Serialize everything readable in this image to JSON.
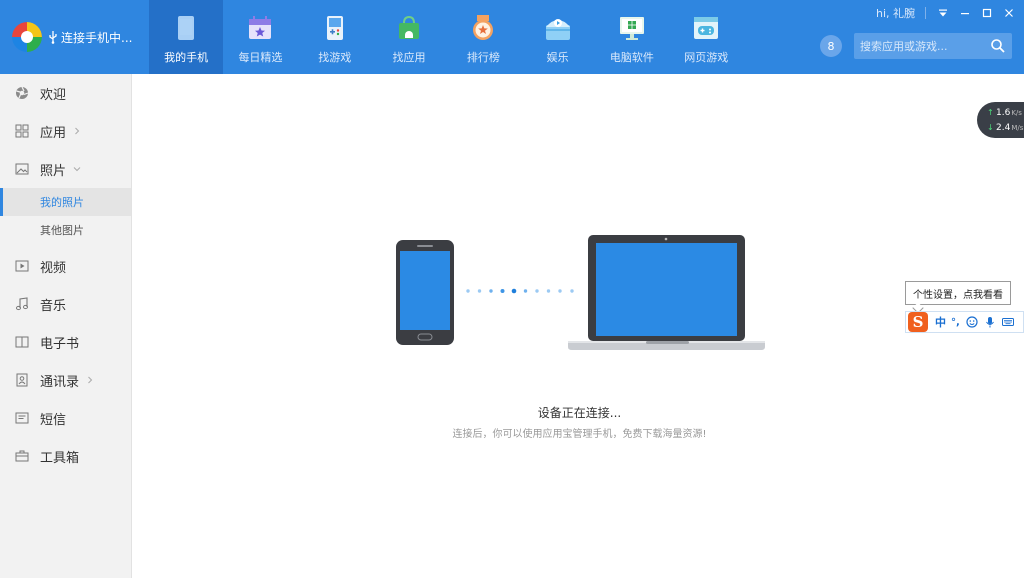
{
  "colors": {
    "header": "#2f86e0",
    "nav_active": "#2470c8",
    "accent": "#2f86e0",
    "device_screen": "#2b8ae4"
  },
  "header": {
    "connection_status": "连接手机中...",
    "greeting": "hi, 礼腕",
    "badge_count": "8",
    "search_placeholder": "搜索应用或游戏..."
  },
  "nav": [
    {
      "label": "我的手机",
      "icon": "phone-icon",
      "active": true
    },
    {
      "label": "每日精选",
      "icon": "calendar-star-icon"
    },
    {
      "label": "找游戏",
      "icon": "gamepad-icon"
    },
    {
      "label": "找应用",
      "icon": "android-bag-icon"
    },
    {
      "label": "排行榜",
      "icon": "medal-icon"
    },
    {
      "label": "娱乐",
      "icon": "entertainment-icon"
    },
    {
      "label": "电脑软件",
      "icon": "monitor-windows-icon"
    },
    {
      "label": "网页游戏",
      "icon": "web-game-icon"
    }
  ],
  "sidebar": {
    "items": [
      {
        "label": "欢迎",
        "icon": "welcome-icon"
      },
      {
        "label": "应用",
        "icon": "apps-grid-icon",
        "expandable": true
      },
      {
        "label": "照片",
        "icon": "photo-icon",
        "expandable": true,
        "expanded": true
      },
      {
        "label": "视频",
        "icon": "video-icon"
      },
      {
        "label": "音乐",
        "icon": "music-icon"
      },
      {
        "label": "电子书",
        "icon": "book-icon"
      },
      {
        "label": "通讯录",
        "icon": "contacts-icon",
        "expandable": true
      },
      {
        "label": "短信",
        "icon": "sms-icon"
      },
      {
        "label": "工具箱",
        "icon": "toolbox-icon"
      }
    ],
    "photo_subitems": [
      {
        "label": "我的照片",
        "active": true
      },
      {
        "label": "其他图片"
      }
    ]
  },
  "main": {
    "status_title": "设备正在连接...",
    "status_subtitle": "连接后，你可以使用应用宝管理手机，免费下载海量资源!"
  },
  "speed": {
    "upload_value": "1.6",
    "upload_unit": "K/s",
    "download_value": "2.4",
    "download_unit": "M/s"
  },
  "ime": {
    "tooltip": "个性设置，点我看看",
    "mode": "中",
    "punct": "°,"
  }
}
